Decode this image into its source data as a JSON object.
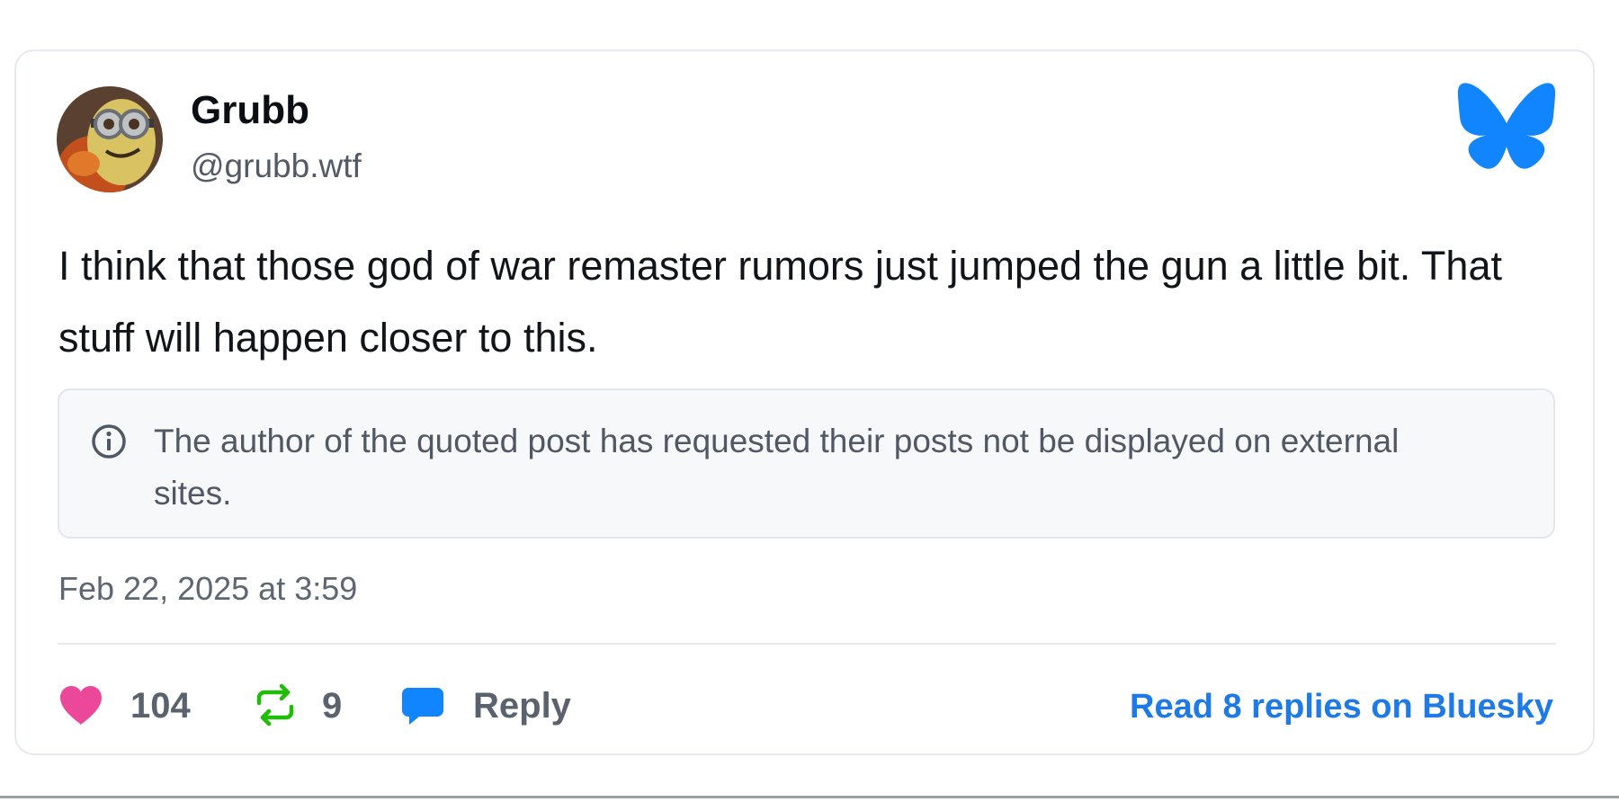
{
  "author": {
    "name": "Grubb",
    "handle": "@grubb.wtf"
  },
  "post": {
    "text": "I think that those god of war remaster rumors just jumped the gun a little bit. That stuff will happen closer to this.",
    "quote_notice": "The author of the quoted post has requested their posts not be displayed on external sites.",
    "timestamp": "Feb 22, 2025 at 3:59"
  },
  "actions": {
    "likes": "104",
    "reposts": "9",
    "reply_label": "Reply",
    "read_replies_label": "Read 8 replies on Bluesky"
  },
  "icons": {
    "brand": "bluesky-butterfly-icon",
    "quote_info": "info-circle-icon",
    "like": "heart-icon",
    "repost": "repost-icon",
    "reply": "speech-bubble-icon"
  },
  "colors": {
    "brand_blue": "#1185fe",
    "like_pink": "#ec4899",
    "repost_green": "#20bc07",
    "link_blue": "#1d7ae6"
  }
}
